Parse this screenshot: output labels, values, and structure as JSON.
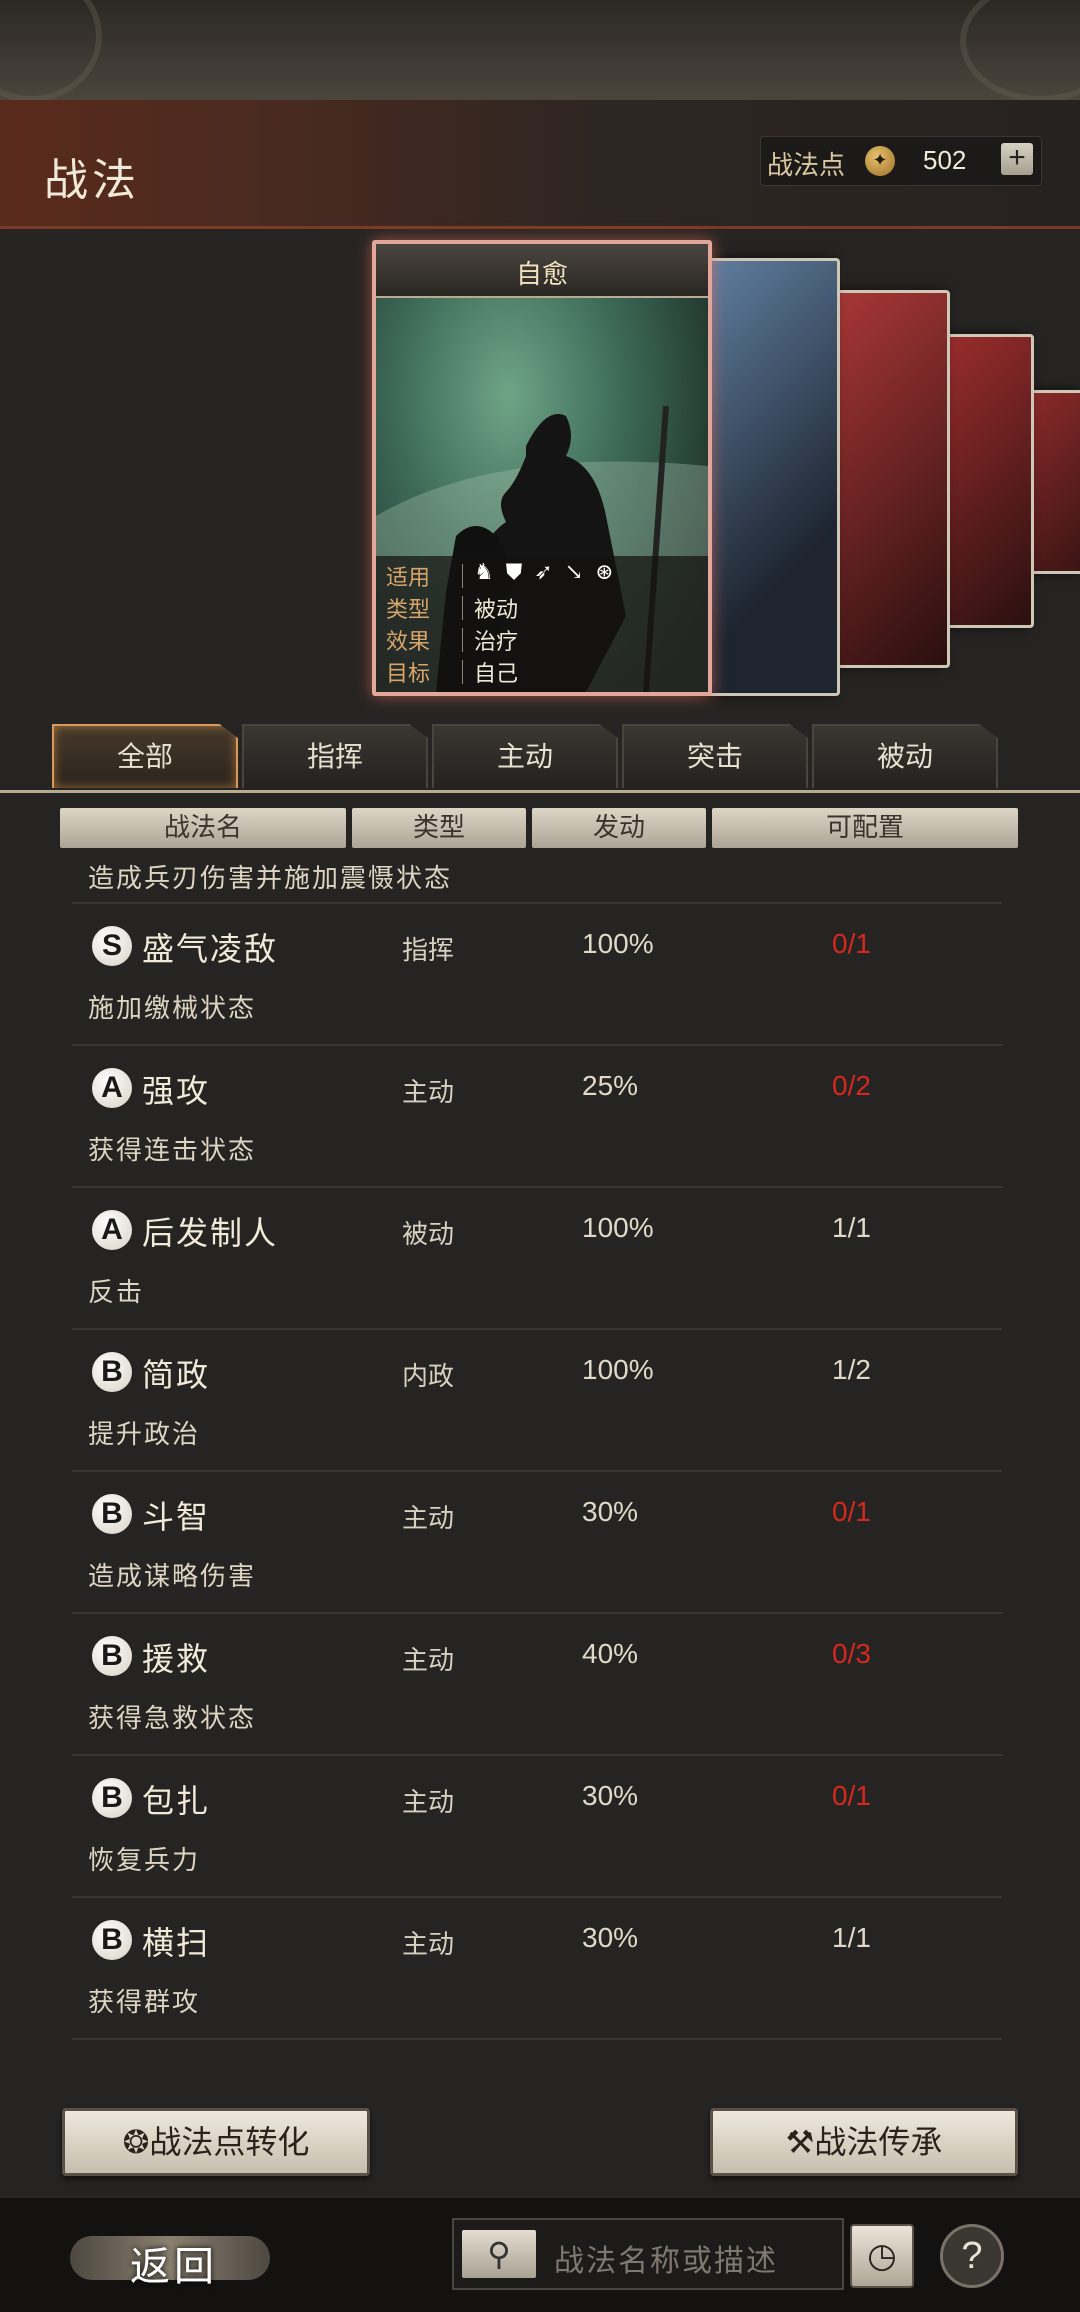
{
  "header": {
    "title": "战法",
    "points_label": "战法点",
    "points_value": "502",
    "plus_label": "+"
  },
  "featured_card": {
    "name": "自愈",
    "rows": [
      {
        "key": "适用",
        "value": ""
      },
      {
        "key": "类型",
        "value": "被动"
      },
      {
        "key": "效果",
        "value": "治疗"
      },
      {
        "key": "目标",
        "value": "自己"
      }
    ],
    "weapon_icons": [
      "cavalry-icon",
      "shield-icon",
      "bow-icon",
      "spear-icon",
      "wheel-icon"
    ]
  },
  "tabs": [
    "全部",
    "指挥",
    "主动",
    "突击",
    "被动"
  ],
  "active_tab": "全部",
  "columns": [
    "战法名",
    "类型",
    "发动",
    "可配置"
  ],
  "partial_row_desc": "造成兵刃伤害并施加震慑状态",
  "skills": [
    {
      "grade": "S",
      "name": "盛气凌敌",
      "type": "指挥",
      "rate": "100%",
      "config": "0/1",
      "config_full": true,
      "desc": "施加缴械状态"
    },
    {
      "grade": "A",
      "name": "强攻",
      "type": "主动",
      "rate": "25%",
      "config": "0/2",
      "config_full": true,
      "desc": "获得连击状态"
    },
    {
      "grade": "A",
      "name": "后发制人",
      "type": "被动",
      "rate": "100%",
      "config": "1/1",
      "config_full": false,
      "desc": "反击"
    },
    {
      "grade": "B",
      "name": "简政",
      "type": "内政",
      "rate": "100%",
      "config": "1/2",
      "config_full": false,
      "desc": "提升政治"
    },
    {
      "grade": "B",
      "name": "斗智",
      "type": "主动",
      "rate": "30%",
      "config": "0/1",
      "config_full": true,
      "desc": "造成谋略伤害"
    },
    {
      "grade": "B",
      "name": "援救",
      "type": "主动",
      "rate": "40%",
      "config": "0/3",
      "config_full": true,
      "desc": "获得急救状态"
    },
    {
      "grade": "B",
      "name": "包扎",
      "type": "主动",
      "rate": "30%",
      "config": "0/1",
      "config_full": true,
      "desc": "恢复兵力"
    },
    {
      "grade": "B",
      "name": "横扫",
      "type": "主动",
      "rate": "30%",
      "config": "1/1",
      "config_full": false,
      "desc": "获得群攻"
    }
  ],
  "buttons": {
    "convert": "战法点转化",
    "inherit": "战法传承"
  },
  "bottom": {
    "back": "返回",
    "search_placeholder": "战法名称或描述",
    "help": "?"
  },
  "colors": {
    "unavailable_red": "#d4281e",
    "active_tab_border": "#d89a55"
  }
}
